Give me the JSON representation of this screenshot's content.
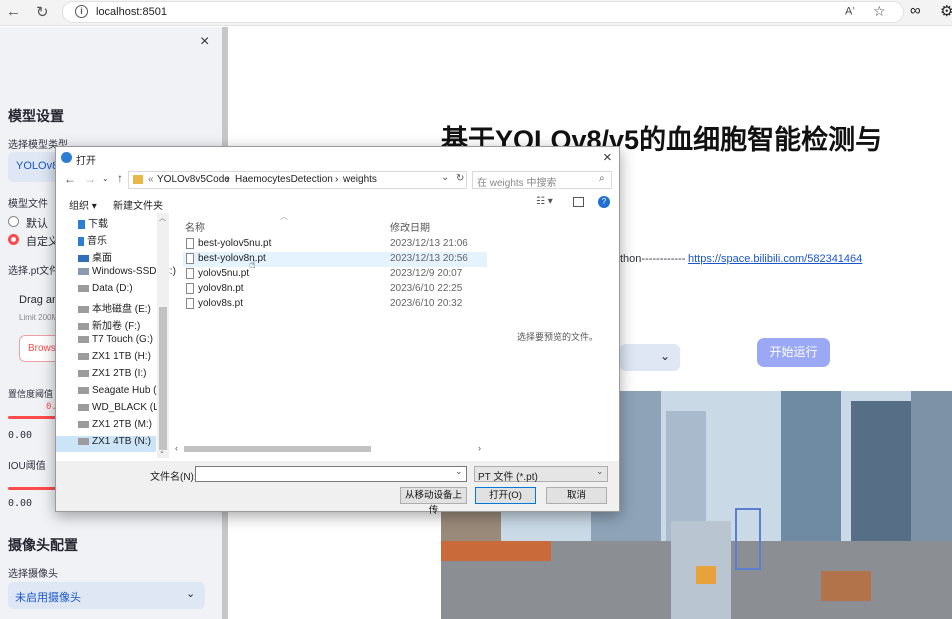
{
  "browser": {
    "url": "localhost:8501",
    "back_icon": "back-arrow-icon",
    "refresh_icon": "refresh-icon"
  },
  "sidebar": {
    "close_icon": "×",
    "model_settings_heading": "模型设置",
    "model_type_label": "选择模型类型",
    "model_type_value": "YOLOv8",
    "model_file_label": "模型文件",
    "radio_default": "默认",
    "radio_custom": "自定义",
    "pt_file_label": "选择.pt文件",
    "drag_text": "Drag and drop file here",
    "limit_text": "Limit 200MB per file",
    "browse_label": "Browse files",
    "conf_label": "置信度阈值",
    "conf_thumb_value": "0.25",
    "conf_min": "0.00",
    "iou_label": "IOU阈值",
    "iou_min": "0.00",
    "camera_heading": "摄像头配置",
    "camera_label": "选择摄像头",
    "camera_value": "未启用摄像头",
    "accent": "#ff4b4b"
  },
  "main": {
    "title": "基于YOLOv8/v5的血细胞智能检测与",
    "link_prefix": "thon------------",
    "link": "https://space.bilibili.com/582341464",
    "run_button": "开始运行"
  },
  "dialog": {
    "title": "打开",
    "close_icon": "×",
    "breadcrumb": [
      "YOLOv8v5Code",
      "HaemocytesDetection",
      "weights"
    ],
    "search_placeholder": "在 weights 中搜索",
    "organize": "组织 ▾",
    "new_folder": "新建文件夹",
    "tree": [
      "下载",
      "音乐",
      "桌面",
      "Windows-SSD (C:)",
      "Data (D:)",
      "本地磁盘 (E:)",
      "新加卷 (F:)",
      "T7 Touch (G:)",
      "ZX1 1TB (H:)",
      "ZX1 2TB (I:)",
      "Seagate Hub (K:)",
      "WD_BLACK (L:)",
      "ZX1 2TB (M:)",
      "ZX1 4TB (N:)"
    ],
    "col_name": "名称",
    "col_date": "修改日期",
    "files": [
      {
        "name": "best-yolov5nu.pt",
        "date": "2023/12/13 21:06"
      },
      {
        "name": "best-yolov8n.pt",
        "date": "2023/12/13 20:56"
      },
      {
        "name": "yolov5nu.pt",
        "date": "2023/12/9 20:07"
      },
      {
        "name": "yolov8n.pt",
        "date": "2023/6/10 22:25"
      },
      {
        "name": "yolov8s.pt",
        "date": "2023/6/10 20:32"
      }
    ],
    "preview_hint": "选择要预览的文件。",
    "filename_label": "文件名(N):",
    "filename_value": "",
    "filetype_value": "PT 文件 (*.pt)",
    "mobile_upload": "从移动设备上传",
    "open_button": "打开(O)",
    "cancel_button": "取消"
  }
}
